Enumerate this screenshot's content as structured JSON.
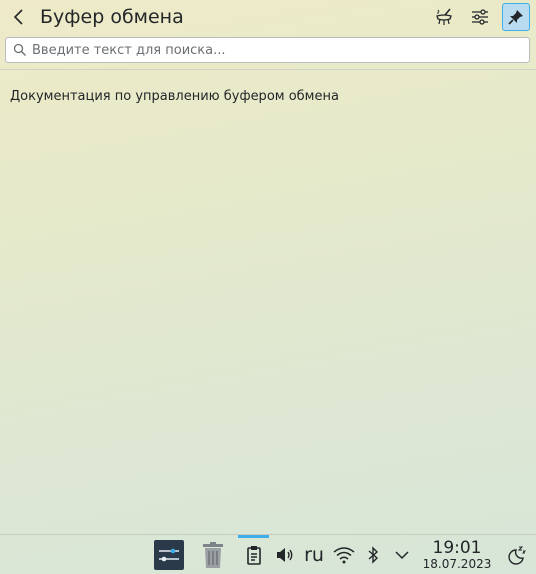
{
  "header": {
    "title": "Буфер обмена",
    "back_icon": "chevron-left-icon",
    "buttons": [
      {
        "name": "clear-history",
        "icon": "broom-clear-icon"
      },
      {
        "name": "configure",
        "icon": "sliders-icon"
      },
      {
        "name": "pin",
        "icon": "pin-icon",
        "active": true
      }
    ]
  },
  "search": {
    "placeholder": "Введите текст для поиска..."
  },
  "content": {
    "help_link": "Документация по управлению буфером обмена"
  },
  "taskbar": {
    "language": "ru",
    "clock": {
      "time": "19:01",
      "date": "18.07.2023"
    },
    "items": [
      {
        "name": "system-settings",
        "icon": "sliders-app-icon"
      },
      {
        "name": "trash",
        "icon": "trash-icon"
      },
      {
        "name": "clipboard",
        "icon": "clipboard-icon",
        "active": true
      },
      {
        "name": "volume",
        "icon": "speaker-icon"
      },
      {
        "name": "keyboard-layout",
        "icon": "language-text"
      },
      {
        "name": "network",
        "icon": "wifi-icon"
      },
      {
        "name": "bluetooth",
        "icon": "bluetooth-icon"
      },
      {
        "name": "tray-expander",
        "icon": "chevron-down-icon"
      },
      {
        "name": "night-mode",
        "icon": "moon-sleep-icon"
      }
    ]
  },
  "colors": {
    "accent": "#3daee9",
    "text": "#232629"
  }
}
